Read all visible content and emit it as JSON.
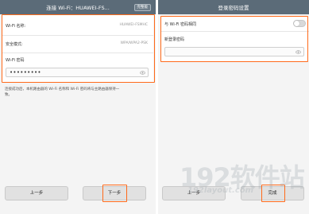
{
  "left_screen": {
    "title": "连接 Wi-Fi：HUAWEI-FS...",
    "title_button": "完整版",
    "wifi_name_label": "Wi-Fi 名称:",
    "wifi_name_value": "HUAWEI-FSMHC",
    "security_label": "安全模式:",
    "security_value": "WPA/WPA2-PSK",
    "wifi_password_label": "Wi-Fi 密码",
    "wifi_password_value": "•••••••••",
    "note_line1": "连接成功后，本机路由器的 Wi-Fi 名称和 Wi-Fi 密码将与主路由器保持一",
    "note_line2": "致。",
    "prev_button": "上一步",
    "next_button": "下一步"
  },
  "right_screen": {
    "title": "登录密码设置",
    "same_as_wifi_label": "与 Wi-Fi 密码相同",
    "same_as_wifi_enabled": false,
    "new_password_label": "新登录密码",
    "new_password_value": "",
    "prev_button": "上一步",
    "done_button": "完成"
  },
  "watermark": {
    "main": "192软件站",
    "sub": "192layout.com"
  },
  "colors": {
    "titlebar": "#5b6b78",
    "highlight": "#ff6a1a",
    "background": "#f4f4f4"
  }
}
